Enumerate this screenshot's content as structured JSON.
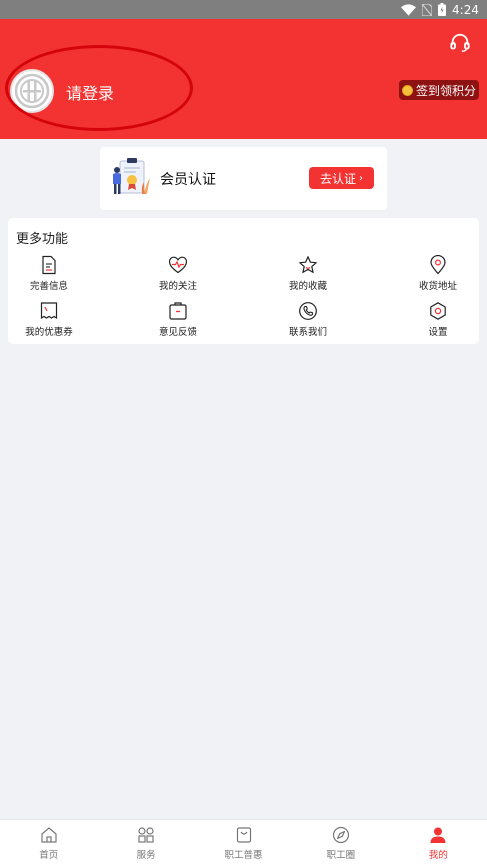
{
  "status_bar": {
    "time": "4:24"
  },
  "header": {
    "login_prompt": "请登录",
    "signin_label": "签到领积分"
  },
  "member_card": {
    "title": "会员认证",
    "button_label": "去认证"
  },
  "functions": {
    "title": "更多功能",
    "items": [
      {
        "label": "完善信息",
        "icon": "document-icon"
      },
      {
        "label": "我的关注",
        "icon": "heart-pulse-icon"
      },
      {
        "label": "我的收藏",
        "icon": "star-icon"
      },
      {
        "label": "收货地址",
        "icon": "location-pin-icon"
      },
      {
        "label": "我的优惠券",
        "icon": "coupon-icon"
      },
      {
        "label": "意见反馈",
        "icon": "feedback-icon"
      },
      {
        "label": "联系我们",
        "icon": "phone-icon"
      },
      {
        "label": "设置",
        "icon": "settings-hexagon-icon"
      }
    ]
  },
  "bottom_nav": {
    "items": [
      {
        "label": "首页",
        "icon": "home-icon"
      },
      {
        "label": "服务",
        "icon": "grid-icon"
      },
      {
        "label": "职工普惠",
        "icon": "shopping-bag-icon"
      },
      {
        "label": "职工圈",
        "icon": "compass-icon"
      },
      {
        "label": "我的",
        "icon": "user-icon"
      }
    ],
    "active_index": 4
  },
  "colors": {
    "brand_red": "#f33232",
    "signin_bg": "#8e1211",
    "annotation_red": "#d4050a"
  }
}
